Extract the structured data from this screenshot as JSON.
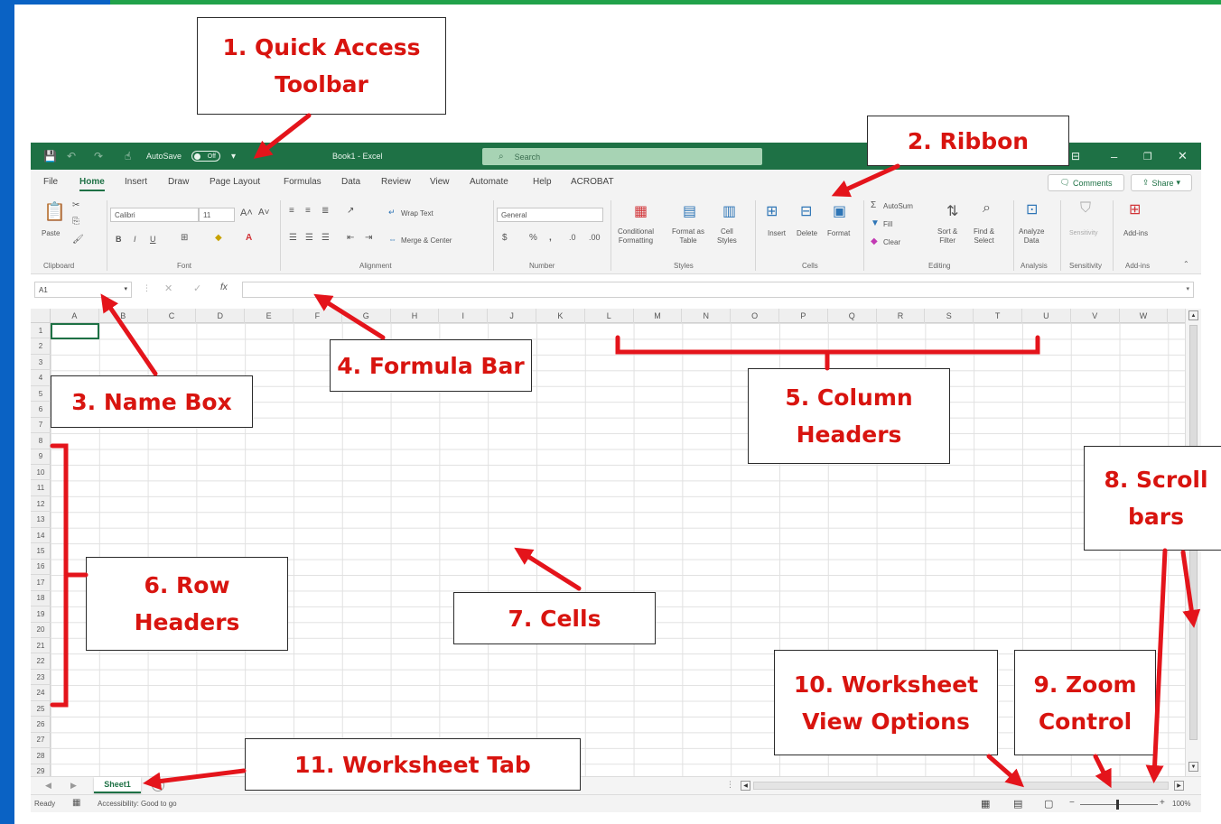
{
  "titlebar": {
    "autosave_label": "AutoSave",
    "autosave_state": "Off",
    "doc_title": "Book1 - Excel",
    "search_placeholder": "Search"
  },
  "tabs": [
    "File",
    "Home",
    "Insert",
    "Draw",
    "Page Layout",
    "Formulas",
    "Data",
    "Review",
    "View",
    "Automate",
    "Help",
    "ACROBAT"
  ],
  "active_tab": "Home",
  "comments_label": "Comments",
  "share_label": "Share",
  "ribbon": {
    "clipboard": {
      "paste": "Paste",
      "label": "Clipboard"
    },
    "font": {
      "name": "Calibri",
      "size": "11",
      "label": "Font"
    },
    "alignment": {
      "wrap": "Wrap Text",
      "merge": "Merge & Center",
      "label": "Alignment"
    },
    "number": {
      "format": "General",
      "label": "Number"
    },
    "styles": {
      "conditional": "Conditional\nFormatting",
      "format_table": "Format as\nTable",
      "cell_styles": "Cell\nStyles",
      "label": "Styles"
    },
    "cells": {
      "insert": "Insert",
      "delete": "Delete",
      "format": "Format",
      "label": "Cells"
    },
    "editing": {
      "autosum": "AutoSum",
      "fill": "Fill",
      "clear": "Clear",
      "sort": "Sort &\nFilter",
      "find": "Find &\nSelect",
      "label": "Editing"
    },
    "analysis": {
      "analyze": "Analyze\nData",
      "label": "Analysis"
    },
    "sensitivity": {
      "button": "Sensitivity",
      "label": "Sensitivity"
    },
    "addins": {
      "button": "Add-ins",
      "label": "Add-ins"
    }
  },
  "formula_bar": {
    "namebox": "A1",
    "fx": "fx"
  },
  "columns": [
    "A",
    "B",
    "C",
    "D",
    "E",
    "F",
    "G",
    "H",
    "I",
    "J",
    "K",
    "L",
    "M",
    "N",
    "O",
    "P",
    "Q",
    "R",
    "S",
    "T",
    "U",
    "V",
    "W"
  ],
  "rows": [
    "1",
    "2",
    "3",
    "4",
    "5",
    "6",
    "7",
    "8",
    "9",
    "10",
    "11",
    "12",
    "13",
    "14",
    "15",
    "16",
    "17",
    "18",
    "19",
    "20",
    "21",
    "22",
    "23",
    "24",
    "25",
    "26",
    "27",
    "28",
    "29"
  ],
  "sheet_tab": "Sheet1",
  "status": {
    "ready": "Ready",
    "accessibility": "Accessibility: Good to go",
    "zoom": "100%"
  },
  "callouts": {
    "qat": "1. Quick Access\nToolbar",
    "ribbon": "2. Ribbon",
    "namebox": "3. Name Box",
    "formula": "4. Formula Bar",
    "colhdrs": "5. Column\nHeaders",
    "rowhdrs": "6. Row\nHeaders",
    "cells": "7. Cells",
    "scroll": "8. Scroll\nbars",
    "zoom": "9. Zoom\nControl",
    "viewopts": "10. Worksheet\nView Options",
    "sheettab": "11. Worksheet Tab"
  },
  "colors": {
    "excel_green": "#1e7145",
    "callout_red": "#d8140f",
    "frame_blue": "#0a62c4"
  }
}
